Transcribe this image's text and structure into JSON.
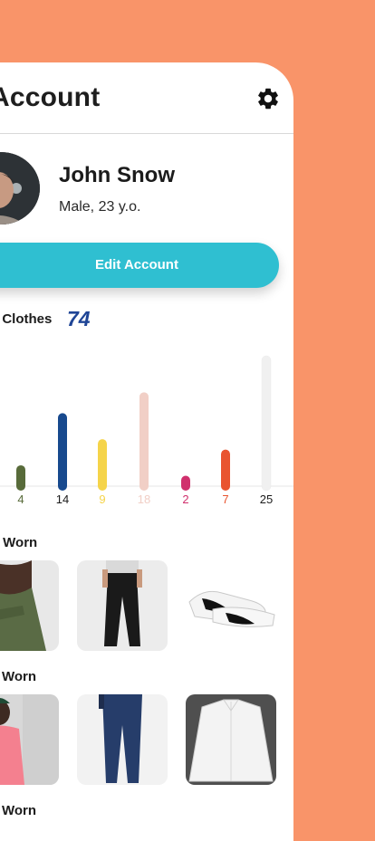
{
  "header": {
    "title": "Account",
    "settings_icon": "gear-icon"
  },
  "profile": {
    "name": "John Snow",
    "meta": "Male, 23 y.o.",
    "avatar_icon": "avatar"
  },
  "actions": {
    "edit_label": "Edit Account",
    "edit_color": "#2FBFD1"
  },
  "clothes": {
    "label": "l Clothes",
    "count": "74"
  },
  "chart_data": {
    "type": "bar",
    "values": [
      4,
      14,
      9,
      18,
      2,
      7,
      25
    ],
    "colors": [
      "#586B3A",
      "#17498E",
      "#F5D44A",
      "#F1CFC6",
      "#D0306D",
      "#E9542F",
      "#F0F0F0"
    ],
    "label_colors": [
      "#586B3A",
      "#1b1b1b",
      "#F5D44A",
      "#F1CFC6",
      "#D0306D",
      "#E9542F",
      "#1b1b1b"
    ],
    "tick_labels": [
      "4",
      "14",
      "9",
      "18",
      "2",
      "7",
      "25"
    ]
  },
  "sections": [
    {
      "title": "t Worn",
      "items": [
        "green-shirt-photo",
        "black-pants-photo",
        "sneakers-photo"
      ]
    },
    {
      "title": "Worn",
      "items": [
        "pink-shirt-photo",
        "jeans-photo",
        "white-shirt-photo"
      ]
    },
    {
      "title": "Worn"
    }
  ],
  "colors": {
    "background": "#F99469",
    "card": "#FFFFFF",
    "accent": "#2FBFD1",
    "count": "#1F4596"
  }
}
